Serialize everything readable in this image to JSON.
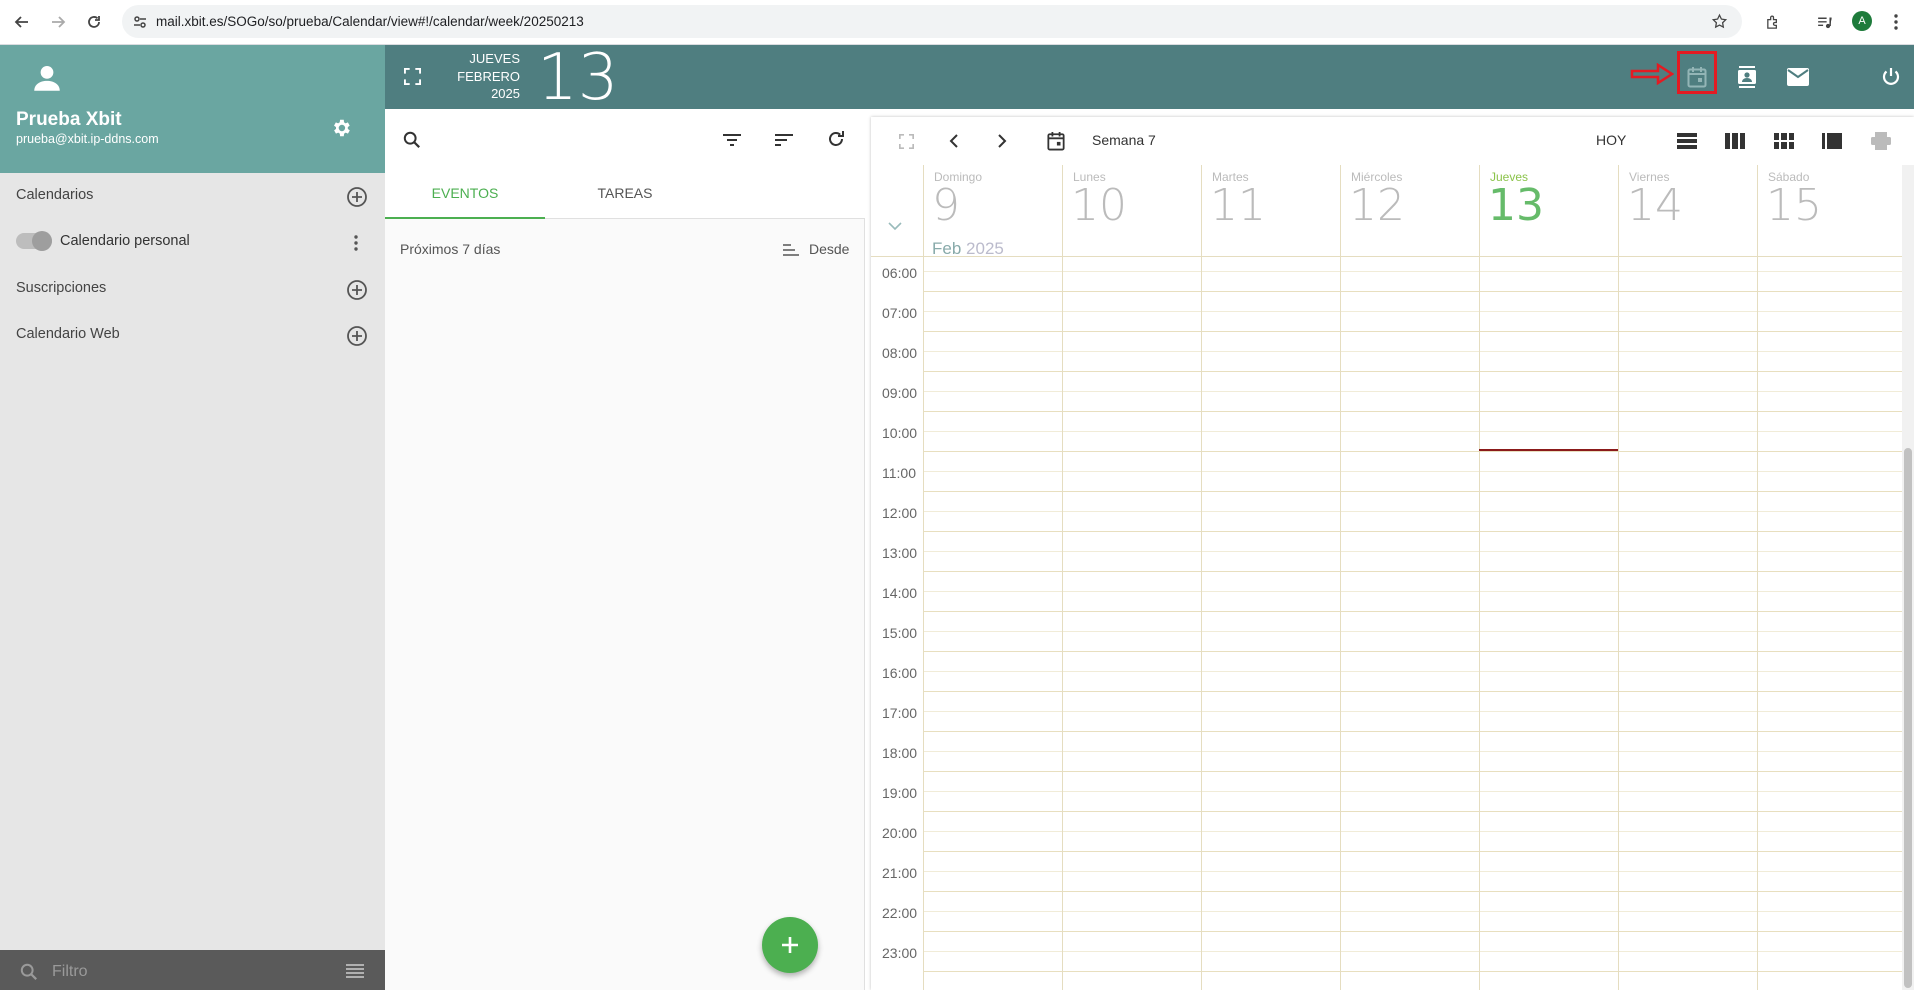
{
  "browser": {
    "url": "mail.xbit.es/SOGo/so/prueba/Calendar/view#!/calendar/week/20250213",
    "profile_initial": "A"
  },
  "sidebar": {
    "user_name": "Prueba Xbit",
    "user_email": "prueba@xbit.ip-ddns.com",
    "calendars_label": "Calendarios",
    "personal_calendar_label": "Calendario personal",
    "subscriptions_label": "Suscripciones",
    "web_calendar_label": "Calendario Web",
    "filter_placeholder": "Filtro"
  },
  "topbar": {
    "weekday": "JUEVES",
    "month": "FEBRERO",
    "year": "2025",
    "day": "13"
  },
  "list": {
    "tab_events": "EVENTOS",
    "tab_tasks": "TAREAS",
    "upcoming_label": "Próximos 7 días",
    "sort_label": "Desde",
    "fab_label": "+"
  },
  "calendar": {
    "week_label": "Semana 7",
    "today_button": "HOY",
    "month_label": "Feb",
    "year_label": "2025",
    "days": [
      {
        "name": "Domingo",
        "num": "9"
      },
      {
        "name": "Lunes",
        "num": "10"
      },
      {
        "name": "Martes",
        "num": "11"
      },
      {
        "name": "Miércoles",
        "num": "12"
      },
      {
        "name": "Jueves",
        "num": "13",
        "today": true
      },
      {
        "name": "Viernes",
        "num": "14"
      },
      {
        "name": "Sábado",
        "num": "15"
      }
    ],
    "hours": [
      "06:00",
      "07:00",
      "08:00",
      "09:00",
      "10:00",
      "11:00",
      "12:00",
      "13:00",
      "14:00",
      "15:00",
      "16:00",
      "17:00",
      "18:00",
      "19:00",
      "20:00",
      "21:00",
      "22:00",
      "23:00"
    ],
    "current_time": "10:15"
  },
  "colors": {
    "accent": "#4caf50",
    "header": "#4f7e80",
    "profile": "#6aa6a1",
    "highlight": "#e31b23"
  }
}
